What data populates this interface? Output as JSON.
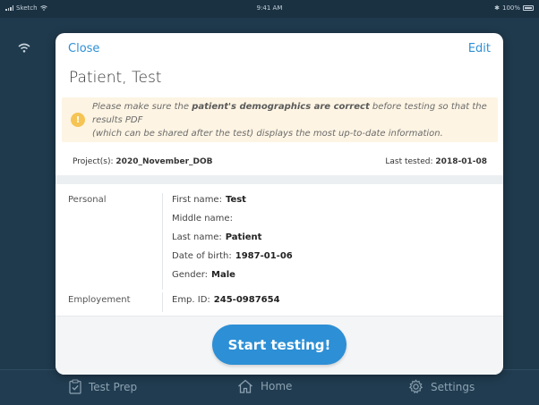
{
  "statusbar": {
    "carrier": "Sketch",
    "time": "9:41 AM",
    "battery": "100%"
  },
  "modal": {
    "close_label": "Close",
    "edit_label": "Edit",
    "patient_name": "Patient, Test",
    "warning": {
      "prefix": "Please make sure the ",
      "emphasis": "patient's demographics are correct",
      "suffix_line1": " before testing so that the results PDF",
      "line2": "(which can be shared after the test) displays the most up-to-date information."
    },
    "projects_label": "Project(s):",
    "projects_value": "2020_November_DOB",
    "last_tested_label": "Last tested:",
    "last_tested_value": "2018-01-08",
    "personal_label": "Personal",
    "personal_fields": [
      {
        "label": "First name:",
        "value": "Test"
      },
      {
        "label": "Middle name:",
        "value": ""
      },
      {
        "label": "Last name:",
        "value": "Patient"
      },
      {
        "label": "Date of birth:",
        "value": "1987-01-06"
      },
      {
        "label": "Gender:",
        "value": "Male"
      }
    ],
    "employment_label": "Employement",
    "employment_fields": [
      {
        "label": "Emp. ID:",
        "value": "245-0987654"
      }
    ],
    "start_button_label": "Start testing!"
  },
  "tabbar": {
    "tabs": [
      {
        "label": "Test Prep",
        "icon": "clipboard-check-icon"
      },
      {
        "label": "Home",
        "icon": "home-icon"
      },
      {
        "label": "Settings",
        "icon": "gear-icon"
      }
    ]
  },
  "colors": {
    "accent": "#2d8fd5",
    "warning_bg": "#fdf4e3",
    "warning_icon": "#f5c454",
    "tab_indicator": "#e89a3c",
    "background": "#1d3547"
  }
}
